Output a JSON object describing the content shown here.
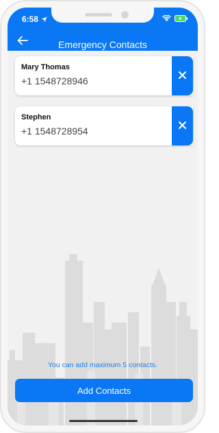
{
  "status_bar": {
    "time": "6:58"
  },
  "header": {
    "title": "Emergency Contacts"
  },
  "contacts": [
    {
      "name": "Mary Thomas",
      "phone": "+1 1548728946"
    },
    {
      "name": "Stephen",
      "phone": "+1 1548728954"
    }
  ],
  "footer": {
    "info": "You can add maximum 5 contacts.",
    "add_button_label": "Add Contacts"
  },
  "icons": {
    "back": "arrow-left-icon",
    "remove": "close-icon",
    "location": "location-arrow-icon",
    "wifi": "wifi-icon",
    "battery": "battery-charging-icon"
  },
  "colors": {
    "accent": "#0a77f5",
    "info_text": "#1f7fe6",
    "background": "#f1f1f1"
  }
}
